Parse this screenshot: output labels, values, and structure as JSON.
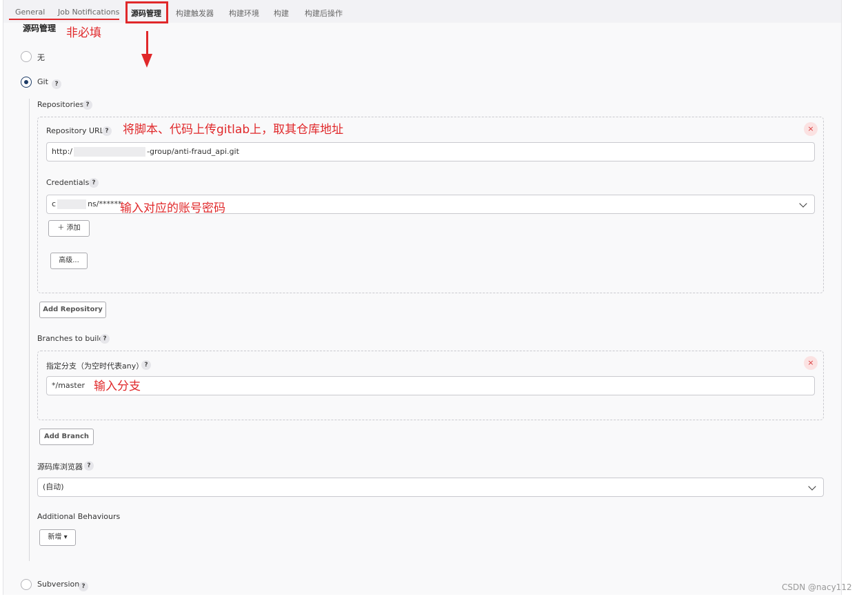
{
  "tabs": [
    {
      "label": "General"
    },
    {
      "label": "Job Notifications"
    },
    {
      "label": "源码管理"
    },
    {
      "label": "构建触发器"
    },
    {
      "label": "构建环境"
    },
    {
      "label": "构建"
    },
    {
      "label": "构建后操作"
    }
  ],
  "section": {
    "title": "源码管理"
  },
  "scm_options": {
    "none": "无",
    "git": "Git",
    "subversion": "Subversion",
    "selected": "Git"
  },
  "git": {
    "repositories_label": "Repositories",
    "repository_url_label": "Repository URL",
    "repository_url_value_prefix": "http:/",
    "repository_url_value_suffix": "-group/anti-fraud_api.git",
    "credentials_label": "Credentials",
    "credentials_value_prefix": "c",
    "credentials_value_suffix": "ns/******",
    "add_label": "添加",
    "advanced_label": "高级...",
    "add_repository_label": "Add Repository",
    "branches_label": "Branches to build",
    "branch_specifier_label": "指定分支（为空时代表any）",
    "branch_specifier_value": "*/master",
    "add_branch_label": "Add Branch",
    "repo_browser_label": "源码库浏览器",
    "repo_browser_value": "(自动)",
    "additional_behaviours_label": "Additional Behaviours",
    "new_label": "新增"
  },
  "help": {
    "glyph": "?"
  },
  "delete": {
    "glyph": "×"
  },
  "annotations": {
    "optional": "非必填",
    "repo_url_note": "将脚本、代码上传gitlab上，取其仓库地址",
    "credentials_note": "输入对应的账号密码",
    "branch_note": "输入分支"
  },
  "watermark": "CSDN @nacy112",
  "colors": {
    "annotation_red": "#e0282a",
    "radio_selected": "#1d3b66",
    "delete_bg": "#fbe2e2"
  }
}
